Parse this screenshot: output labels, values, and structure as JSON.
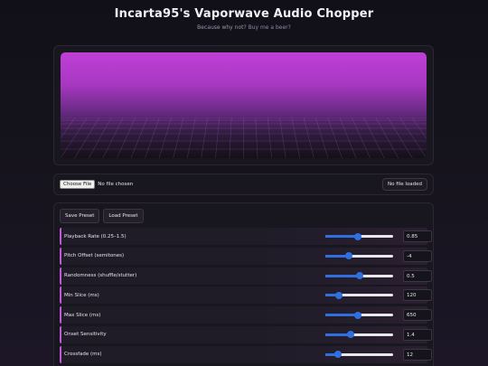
{
  "header": {
    "title": "Incarta95's Vaporwave Audio Chopper",
    "subtitle_prefix": "Because why not?",
    "subtitle_link": "Buy me a beer?"
  },
  "file": {
    "choose_label": "Choose File",
    "chosen_text": "No file chosen",
    "status": "No file loaded"
  },
  "presets": {
    "save_label": "Save Preset",
    "load_label": "Load Preset"
  },
  "controls": [
    {
      "label": "Playback Rate (0.25–1.5)",
      "value": "0.85",
      "level": 0.48
    },
    {
      "label": "Pitch Offset (semitones)",
      "value": "-4",
      "level": 0.35
    },
    {
      "label": "Randomness (shuffle/stutter)",
      "value": "0.5",
      "level": 0.5
    },
    {
      "label": "Min Slice (ms)",
      "value": "120",
      "level": 0.2
    },
    {
      "label": "Max Slice (ms)",
      "value": "650",
      "level": 0.48
    },
    {
      "label": "Onset Sensitivity",
      "value": "1.4",
      "level": 0.37
    },
    {
      "label": "Crossfade (ms)",
      "value": "12",
      "level": 0.18
    }
  ],
  "colors": {
    "accent": "#c05ad6",
    "slider": "#2f6fe0",
    "visual_top": "#c03fd6"
  }
}
